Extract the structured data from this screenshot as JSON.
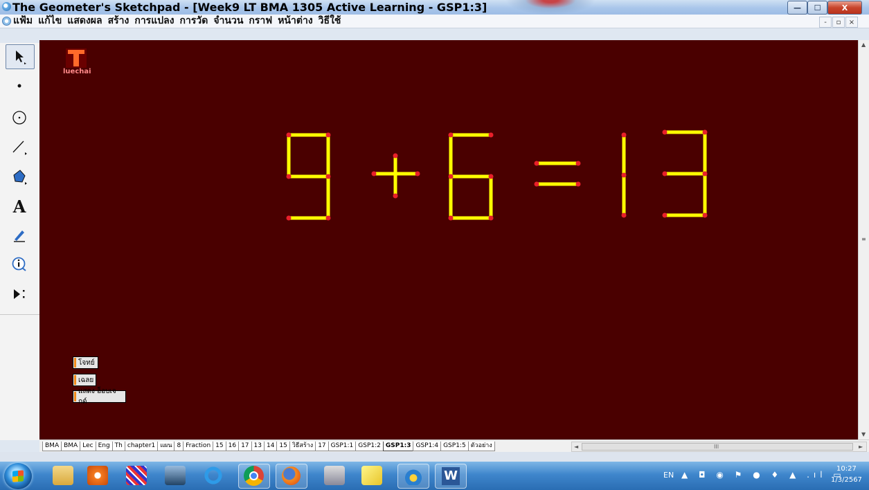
{
  "window": {
    "title": "The Geometer's Sketchpad - [Week9 LT BMA 1305 Active Learning - GSP1:3]",
    "minimize_label": "—",
    "maximize_label": "☐",
    "close_label": "X"
  },
  "menu": {
    "items": [
      "แฟ้ม",
      "แก้ไข",
      "แสดงผล",
      "สร้าง",
      "การแปลง",
      "การวัด",
      "จำนวน",
      "กราฟ",
      "หน้าต่าง",
      "วิธีใช้"
    ],
    "doc_minimize": "-",
    "doc_restore": "▫",
    "doc_close": "×"
  },
  "toolbox": {
    "tools": [
      "arrow-select-tool",
      "point-tool",
      "compass-tool",
      "straightedge-tool",
      "polygon-tool",
      "text-tool",
      "marker-tool",
      "information-tool",
      "custom-tool"
    ],
    "active_tool": "arrow-select-tool",
    "text_tool_glyph": "A"
  },
  "canvas": {
    "background": "#4a0000",
    "logo_caption": "luechai",
    "matchstick_color": "#ffff00",
    "endpoint_color": "#e8202a",
    "buttons": [
      "โจทย์",
      "เฉลย",
      "แสดง อ็อบเจกต์"
    ]
  },
  "sheet_tabs": {
    "tabs": [
      "BMA",
      "BMA",
      "Lec",
      "Eng",
      "Th",
      "chapter1",
      "แผน",
      "8",
      "Fraction",
      "15",
      "16",
      "17",
      "13",
      "14",
      "15",
      "วิธีสร้าง",
      "17",
      "GSP1:1",
      "GSP1:2",
      "GSP1:3",
      "GSP1:4",
      "GSP1:5",
      "ตัวอย่าง"
    ],
    "active_tab": "GSP1:3",
    "hscroll_thumb_glyph": "III"
  },
  "taskbar": {
    "apps": [
      "file-explorer",
      "media-player",
      "paint-app",
      "remote-desktop",
      "internet-explorer",
      "chrome",
      "firefox",
      "keyboard-tool",
      "sticky-notes",
      "sketchpad",
      "word"
    ],
    "tray_lang": "EN",
    "tray_icons": "▲ ◘ ◉ ⚑ ● ♦ ▲ .ıl ▭",
    "clock_time": "10:27",
    "clock_date": "1/3/2567"
  }
}
